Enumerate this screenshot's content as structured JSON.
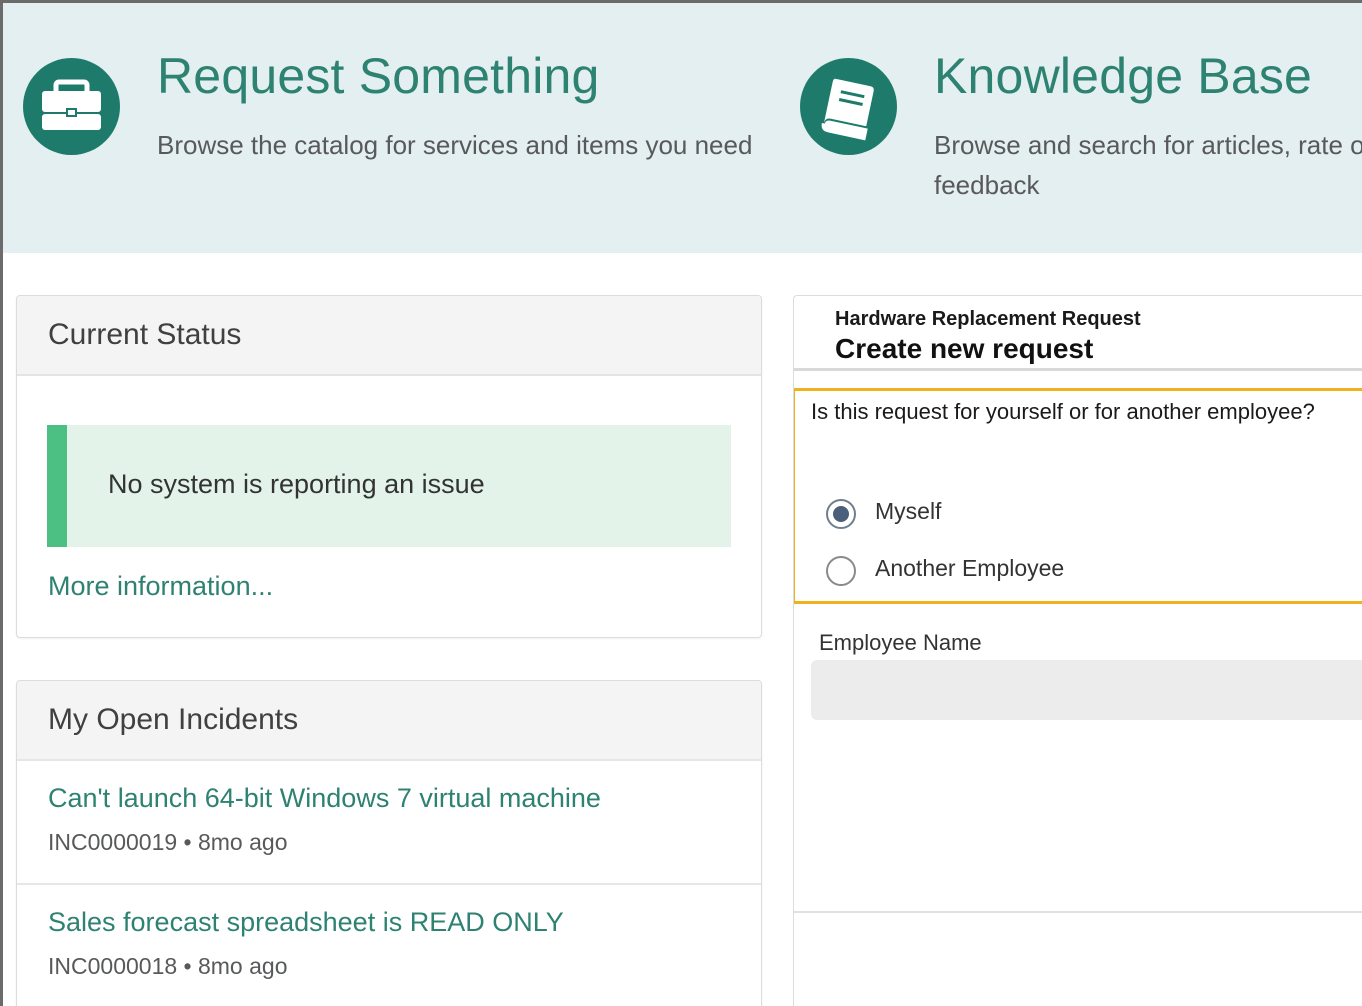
{
  "hero": {
    "request": {
      "title": "Request Something",
      "description": "Browse the catalog for services and items you need",
      "icon": "briefcase-icon"
    },
    "knowledge": {
      "title": "Knowledge Base",
      "description_line1": "Browse and search for articles, rate or submit",
      "description_line2": "feedback",
      "icon": "book-icon"
    }
  },
  "status": {
    "title": "Current Status",
    "message": "No system is reporting an issue",
    "more_link": "More information..."
  },
  "incidents": {
    "title": "My Open Incidents",
    "items": [
      {
        "title": "Can't launch 64-bit Windows 7 virtual machine",
        "meta": "INC0000019 • 8mo ago"
      },
      {
        "title": "Sales forecast spreadsheet is READ ONLY",
        "meta": "INC0000018 • 8mo ago"
      }
    ]
  },
  "form": {
    "subtitle": "Hardware Replacement Request",
    "title": "Create new request",
    "question": "Is this request for yourself or for another employee?",
    "options": [
      {
        "label": "Myself",
        "checked": true
      },
      {
        "label": "Another Employee",
        "checked": false
      }
    ],
    "employee_label": "Employee Name",
    "employee_value": ""
  },
  "colors": {
    "accent": "#1e7b6c",
    "link": "#2e8272",
    "hero_bg": "#e3eff1",
    "status_ok": "#4cbf82",
    "focus": "#f2b01e"
  }
}
